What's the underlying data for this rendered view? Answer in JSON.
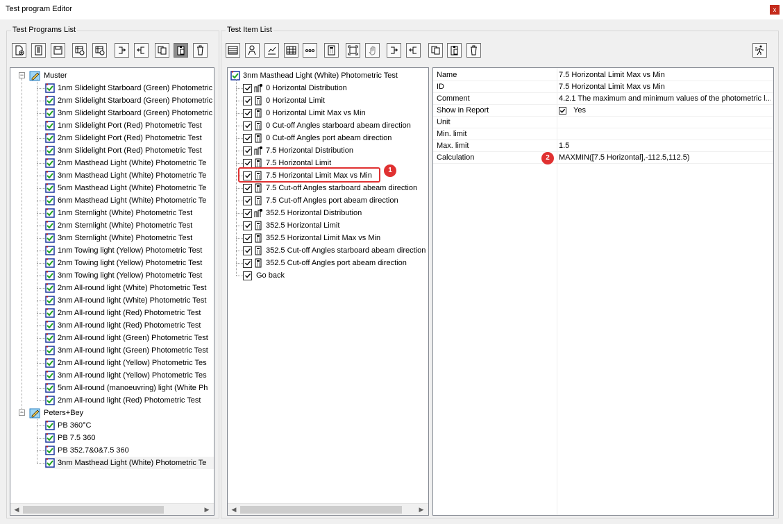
{
  "window": {
    "title": "Test program Editor",
    "close_label": "x"
  },
  "left_group": {
    "label": "Test Programs List"
  },
  "mid_group": {
    "label": "Test Item List"
  },
  "programs": {
    "groups": [
      {
        "name": "Muster",
        "items": [
          "1nm Slidelight Starboard (Green) Photometric",
          "2nm Slidelight Starboard (Green) Photometric",
          "3nm Slidelight Starboard (Green) Photometric",
          "1nm Slidelight Port (Red) Photometric Test",
          "2nm Slidelight Port (Red) Photometric Test",
          "3nm Slidelight Port (Red) Photometric Test",
          "2nm Masthead Light (White) Photometric Te",
          "3nm Masthead Light (White) Photometric Te",
          "5nm Masthead Light (White) Photometric Te",
          "6nm Masthead Light (White) Photometric Te",
          "1nm Sternlight  (White) Photometric Test",
          "2nm Sternlight  (White) Photometric Test",
          "3nm Sternlight  (White) Photometric Test",
          "1nm Towing light (Yellow) Photometric Test",
          "2nm Towing light (Yellow) Photometric Test",
          "3nm Towing light (Yellow) Photometric Test",
          "2nm All-round light (White) Photometric Test",
          "3nm All-round light (White) Photometric Test",
          "2nm All-round light (Red) Photometric Test",
          "3nm All-round light (Red) Photometric Test",
          "2nm All-round light (Green) Photometric Test",
          "3nm All-round light (Green) Photometric Test",
          "2nm All-round light (Yellow) Photometric Tes",
          "3nm All-round light (Yellow) Photometric Tes",
          "5nm All-round (manoeuvring) light (White Ph",
          "2nm All-round light (Red) Photometric Test"
        ]
      },
      {
        "name": "Peters+Bey",
        "items": [
          "PB 360°C",
          "PB 7.5 360",
          "PB 352.7&0&7.5  360",
          "3nm Masthead Light (White) Photometric Te"
        ]
      }
    ]
  },
  "test_items": {
    "root": "3nm Masthead Light (White) Photometric Test",
    "items": [
      {
        "label": "0 Horizontal Distribution",
        "icon": "distribution-icon"
      },
      {
        "label": "0 Horizontal Limit",
        "icon": "calculator-icon"
      },
      {
        "label": "0 Horizontal Limit Max vs Min",
        "icon": "calculator-icon"
      },
      {
        "label": "0 Cut-off Angles starboard abeam direction",
        "icon": "calculator-icon"
      },
      {
        "label": "0 Cut-off Angles port abeam direction",
        "icon": "calculator-icon"
      },
      {
        "label": "7.5 Horizontal Distribution",
        "icon": "distribution-icon"
      },
      {
        "label": "7.5 Horizontal Limit",
        "icon": "calculator-icon"
      },
      {
        "label": "7.5 Horizontal Limit Max vs Min",
        "icon": "calculator-icon"
      },
      {
        "label": "7.5 Cut-off Angles starboard abeam direction",
        "icon": "calculator-icon"
      },
      {
        "label": "7.5 Cut-off Angles port abeam direction",
        "icon": "calculator-icon"
      },
      {
        "label": "352.5 Horizontal Distribution",
        "icon": "distribution-icon"
      },
      {
        "label": "352.5 Horizontal Limit",
        "icon": "calculator-icon"
      },
      {
        "label": "352.5 Horizontal Limit Max vs Min",
        "icon": "calculator-icon"
      },
      {
        "label": "352.5 Cut-off Angles starboard abeam direction",
        "icon": "calculator-icon"
      },
      {
        "label": "352.5 Cut-off Angles port abeam direction",
        "icon": "calculator-icon"
      },
      {
        "label": "Go back",
        "icon": "hand-icon"
      }
    ]
  },
  "properties": [
    {
      "name": "Name",
      "value": "7.5 Horizontal Limit Max vs Min"
    },
    {
      "name": "ID",
      "value": "7.5 Horizontal Limit Max vs Min"
    },
    {
      "name": "Comment",
      "value": "4.2.1 The maximum and minimum values of the photometric l..."
    },
    {
      "name": "Show in Report",
      "value": "Yes",
      "checked": true
    },
    {
      "name": "Unit",
      "value": ""
    },
    {
      "name": "Min. limit",
      "value": ""
    },
    {
      "name": "Max. limit",
      "value": "1.5"
    },
    {
      "name": "Calculation",
      "value": "MAXMIN([7.5 Horizontal],-112.5,112.5)"
    }
  ],
  "badges": {
    "one": "1",
    "two": "2"
  }
}
